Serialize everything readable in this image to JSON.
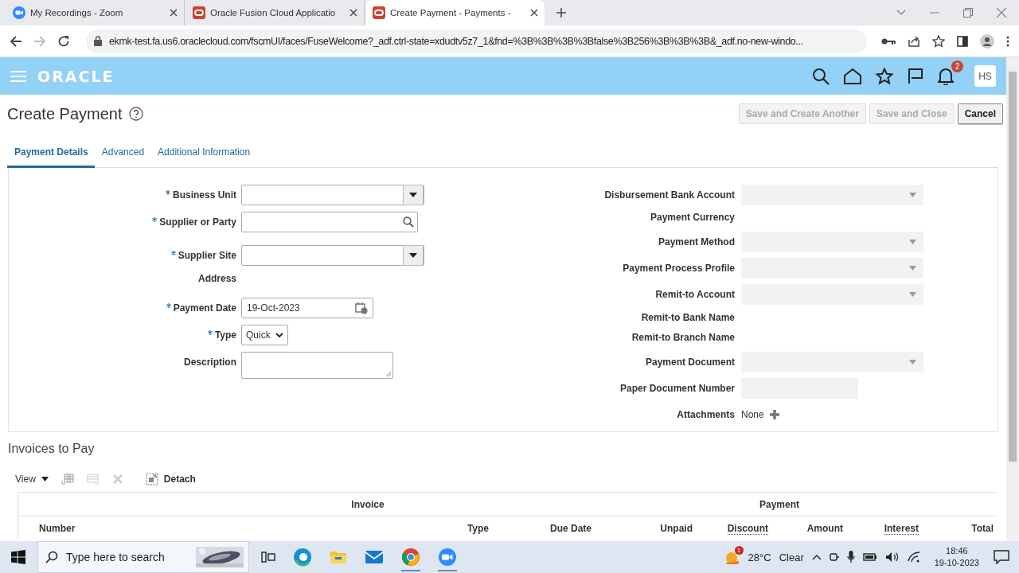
{
  "browser": {
    "tabs": [
      {
        "title": "My Recordings - Zoom",
        "selected": false
      },
      {
        "title": "Oracle Fusion Cloud Applicatio",
        "selected": false
      },
      {
        "title": "Create Payment - Payments -",
        "selected": true
      }
    ],
    "url": "ekmk-test.fa.us6.oraclecloud.com/fscmUI/faces/FuseWelcome?_adf.ctrl-state=xdudtv5z7_1&fnd=%3B%3B%3B%3Bfalse%3B256%3B%3B%3B&_adf.no-new-windo..."
  },
  "header": {
    "logo": "ORACLE",
    "notification_count": "2",
    "avatar": "HS"
  },
  "page": {
    "title": "Create Payment",
    "buttons": [
      {
        "label": "Save and Create Another",
        "disabled": true
      },
      {
        "label": "Save and Close",
        "disabled": true
      },
      {
        "label": "Cancel",
        "disabled": false
      }
    ],
    "tabs": [
      {
        "label": "Payment Details",
        "selected": true
      },
      {
        "label": "Advanced",
        "selected": false
      },
      {
        "label": "Additional Information",
        "selected": false
      }
    ],
    "left_fields": [
      {
        "label": "Business Unit",
        "required": true,
        "kind": "select"
      },
      {
        "label": "Supplier or Party",
        "required": true,
        "kind": "search"
      },
      {
        "label": "Supplier Site",
        "required": true,
        "kind": "select"
      },
      {
        "label": "Address",
        "required": false,
        "kind": "display"
      },
      {
        "label": "Payment Date",
        "required": true,
        "kind": "date",
        "value": "19-Oct-2023"
      },
      {
        "label": "Type",
        "required": true,
        "kind": "choice",
        "value": "Quick"
      },
      {
        "label": "Description",
        "required": false,
        "kind": "textarea"
      }
    ],
    "right_fields": [
      {
        "label": "Disbursement Bank Account",
        "kind": "select"
      },
      {
        "label": "Payment Currency",
        "kind": "display"
      },
      {
        "label": "Payment Method",
        "kind": "select"
      },
      {
        "label": "Payment Process Profile",
        "kind": "select"
      },
      {
        "label": "Remit-to Account",
        "kind": "select"
      },
      {
        "label": "Remit-to Bank Name",
        "kind": "display"
      },
      {
        "label": "Remit-to Branch Name",
        "kind": "display"
      },
      {
        "label": "Payment Document",
        "kind": "select"
      },
      {
        "label": "Paper Document Number",
        "kind": "text"
      },
      {
        "label": "Attachments",
        "kind": "attachments",
        "value": "None"
      }
    ]
  },
  "invoices": {
    "title": "Invoices to Pay",
    "view_menu": "View",
    "detach": "Detach",
    "column_groups": [
      {
        "label": "Invoice"
      },
      {
        "label": "Payment"
      }
    ],
    "columns": [
      {
        "label": "Number",
        "sortable": false
      },
      {
        "label": "Type",
        "sortable": false
      },
      {
        "label": "Due Date",
        "sortable": false
      },
      {
        "label": "Unpaid",
        "sortable": false
      },
      {
        "label": "Discount",
        "sortable": true
      },
      {
        "label": "Amount",
        "sortable": false
      },
      {
        "label": "Interest",
        "sortable": true
      },
      {
        "label": "Total",
        "sortable": false
      }
    ]
  },
  "taskbar": {
    "search_placeholder": "Type here to search",
    "weather_badge": "1",
    "temperature": "28°C",
    "condition": "Clear",
    "time": "18:46",
    "date": "19-10-2023"
  }
}
